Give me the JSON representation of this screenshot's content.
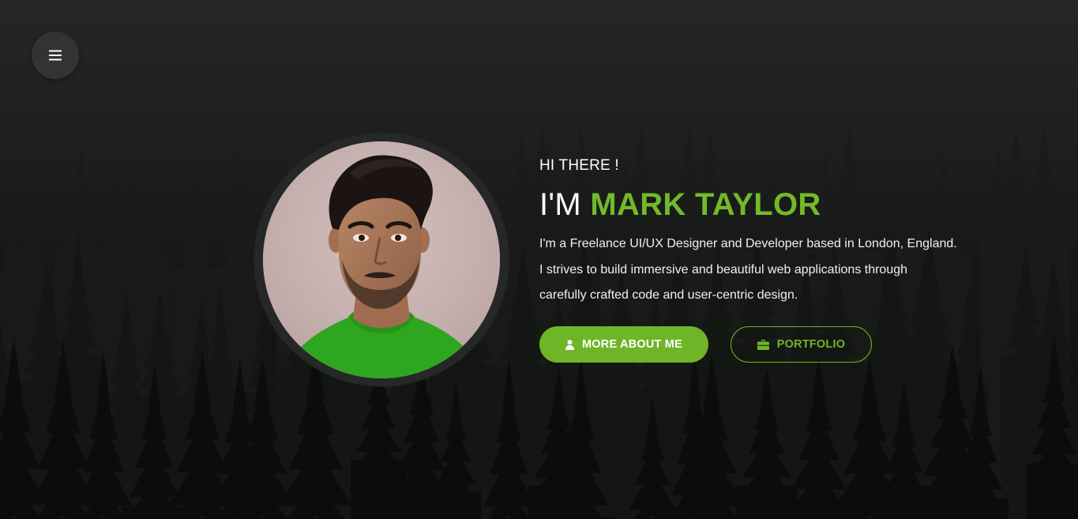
{
  "menu": {
    "icon": "hamburger-icon"
  },
  "hero": {
    "greeting": "HI THERE !",
    "headline_prefix": "I'M",
    "name": "MARK TAYLOR",
    "bio_lines": [
      "I'm a Freelance UI/UX Designer and Developer based in London, England.",
      "I strives to build immersive and beautiful web applications through",
      "carefully crafted code and user-centric design."
    ],
    "buttons": [
      {
        "label": "MORE ABOUT ME",
        "icon": "user-icon"
      },
      {
        "label": "PORTFOLIO",
        "icon": "briefcase-icon"
      }
    ]
  },
  "colors": {
    "accent": "#6fb528",
    "background": "#161616",
    "menu_button": "#333333"
  }
}
